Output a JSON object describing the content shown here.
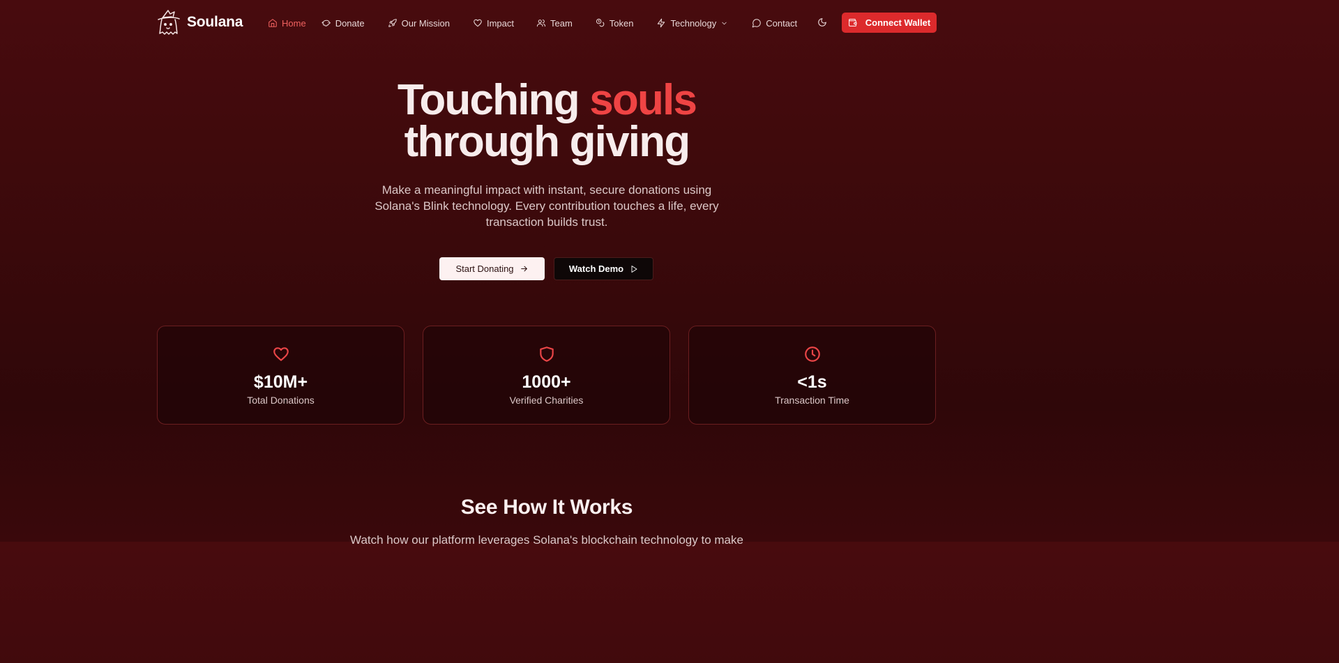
{
  "brand": {
    "name": "Soulana",
    "logo_icon": "witch-ghost-logo-icon"
  },
  "nav": {
    "items": [
      {
        "label": "Home",
        "icon": "home-icon",
        "active": true
      },
      {
        "label": "Donate",
        "icon": "piggy-bank-icon"
      },
      {
        "label": "Our Mission",
        "icon": "rocket-icon"
      },
      {
        "label": "Impact",
        "icon": "heart-icon"
      },
      {
        "label": "Team",
        "icon": "users-icon"
      },
      {
        "label": "Token",
        "icon": "coins-icon"
      },
      {
        "label": "Technology",
        "icon": "zap-icon",
        "dropdown": true
      },
      {
        "label": "Contact",
        "icon": "message-circle-icon"
      }
    ],
    "theme_icon": "moon-icon",
    "connect_wallet": "Connect Wallet"
  },
  "hero": {
    "title_part1": "Touching ",
    "title_accent": "souls",
    "title_line2": "through giving",
    "subtitle": "Make a meaningful impact with instant, secure donations using Solana's Blink technology. Every contribution touches a life, every transaction builds trust.",
    "start_donating": "Start Donating",
    "watch_demo": "Watch Demo"
  },
  "stats": [
    {
      "value": "$10M+",
      "label": "Total Donations",
      "icon": "heart-icon"
    },
    {
      "value": "1000+",
      "label": "Verified Charities",
      "icon": "shield-icon"
    },
    {
      "value": "<1s",
      "label": "Transaction Time",
      "icon": "clock-icon"
    }
  ],
  "how_it_works": {
    "title": "See How It Works",
    "subtitle": "Watch how our platform leverages Solana's blockchain technology to make"
  },
  "colors": {
    "accent": "#ef4444",
    "button_red": "#dc2a2c",
    "background": "#3a090b"
  }
}
